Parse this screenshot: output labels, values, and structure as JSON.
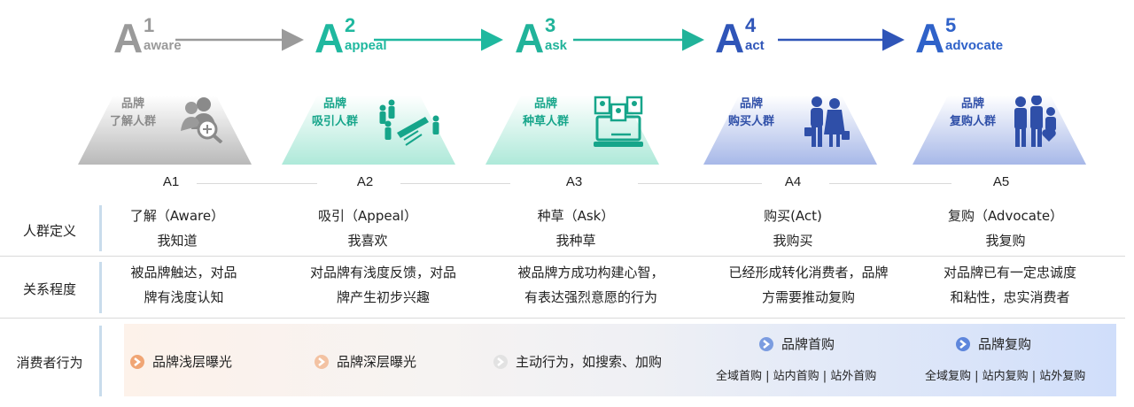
{
  "stages": [
    {
      "big": "A",
      "sup": "1",
      "sub": "aware",
      "color": "#9a9a9a"
    },
    {
      "big": "A",
      "sup": "2",
      "sub": "appeal",
      "color": "#1fb89f"
    },
    {
      "big": "A",
      "sup": "3",
      "sub": "ask",
      "color": "#21b39a"
    },
    {
      "big": "A",
      "sup": "4",
      "sub": "act",
      "color": "#2f55b8"
    },
    {
      "big": "A",
      "sup": "5",
      "sub": "advocate",
      "color": "#2f62c9"
    }
  ],
  "cards": [
    {
      "line1": "品牌",
      "line2": "了解人群",
      "color": "#8a8a8a"
    },
    {
      "line1": "品牌",
      "line2": "吸引人群",
      "color": "#16a58a"
    },
    {
      "line1": "品牌",
      "line2": "种草人群",
      "color": "#16a58a"
    },
    {
      "line1": "品牌",
      "line2": "购买人群",
      "color": "#2f4fa8"
    },
    {
      "line1": "品牌",
      "line2": "复购人群",
      "color": "#2f4fa8"
    }
  ],
  "a_labels": [
    "A1",
    "A2",
    "A3",
    "A4",
    "A5"
  ],
  "rows": {
    "definition": {
      "label": "人群定义",
      "cells": [
        {
          "l1": "了解（Aware）",
          "l2": "我知道"
        },
        {
          "l1": "吸引（Appeal）",
          "l2": "我喜欢"
        },
        {
          "l1": "种草（Ask）",
          "l2": "我种草"
        },
        {
          "l1": "购买(Act)",
          "l2": "我购买"
        },
        {
          "l1": "复购（Advocate）",
          "l2": "我复购"
        }
      ]
    },
    "relationship": {
      "label": "关系程度",
      "cells": [
        {
          "l1": "被品牌触达，对品",
          "l2": "牌有浅度认知"
        },
        {
          "l1": "对品牌有浅度反馈，对品",
          "l2": "牌产生初步兴趣"
        },
        {
          "l1": "被品牌方成功构建心智，",
          "l2": "有表达强烈意愿的行为"
        },
        {
          "l1": "已经形成转化消费者，品牌",
          "l2": "方需要推动复购"
        },
        {
          "l1": "对品牌已有一定忠诚度",
          "l2": "和粘性，忠实消费者"
        }
      ]
    },
    "behavior": {
      "label": "消费者行为",
      "items": [
        {
          "text": "品牌浅层曝光",
          "icon_color": "#f0a574"
        },
        {
          "text": "品牌深层曝光",
          "icon_color": "#f3c2a2"
        },
        {
          "text": "主动行为，如搜索、加购",
          "icon_color": "#e2e2e2"
        },
        {
          "text": "品牌首购",
          "sub": "全域首购 | 站内首购 | 站外首购",
          "icon_color": "#7b9ce0"
        },
        {
          "text": "品牌复购",
          "sub": "全域复购 | 站内复购 | 站外复购",
          "icon_color": "#5e86dc"
        }
      ]
    }
  }
}
